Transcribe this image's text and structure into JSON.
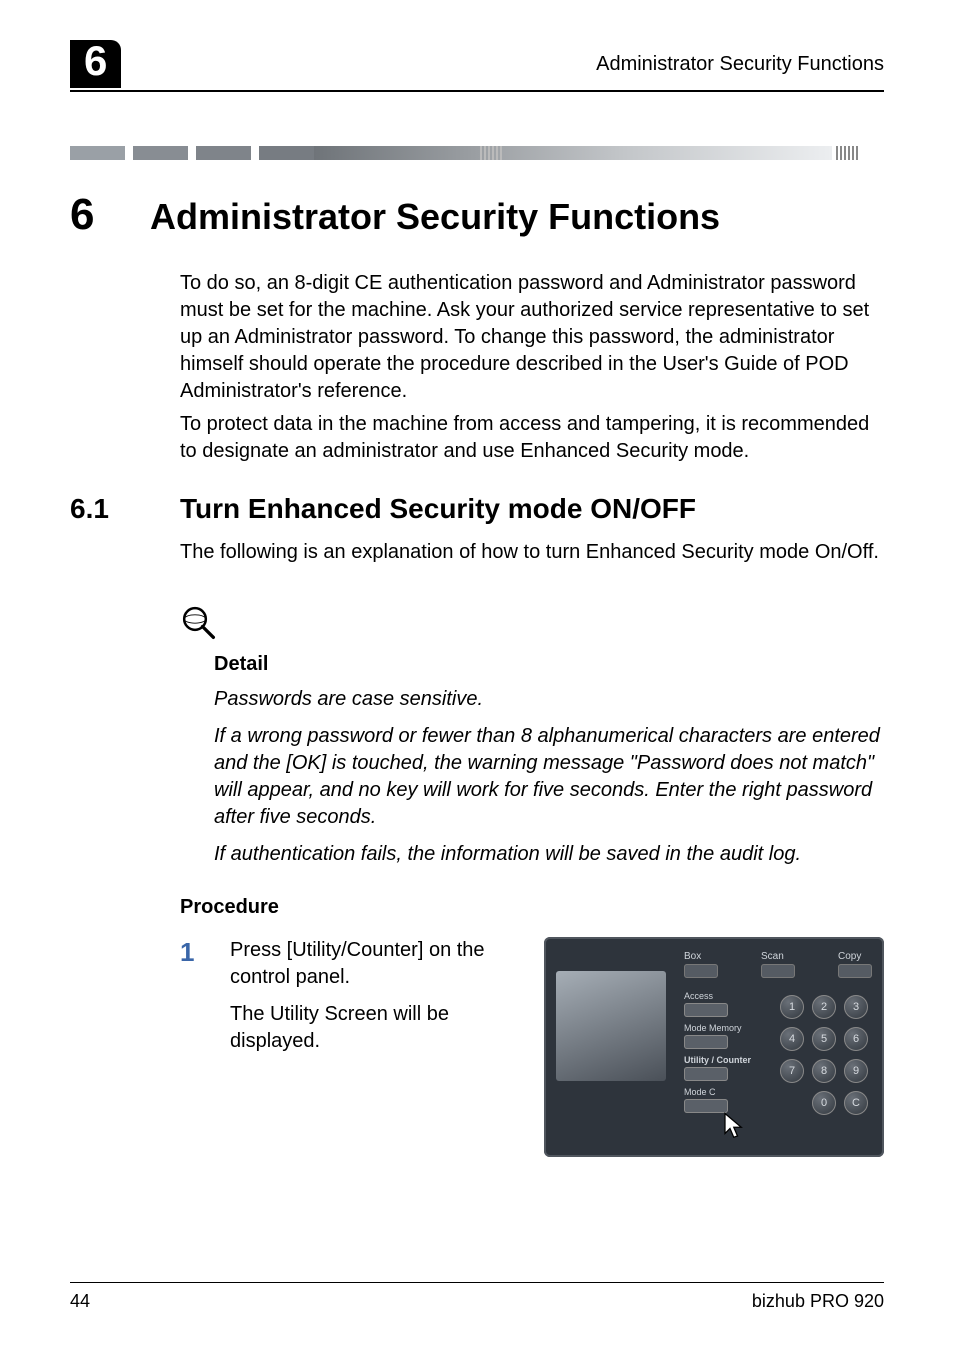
{
  "header": {
    "chapter_badge": "6",
    "running_title": "Administrator Security Functions"
  },
  "chapter": {
    "number": "6",
    "title": "Administrator Security Functions"
  },
  "intro": {
    "p1": "To do so, an 8-digit CE authentication password and Administrator password must be set for the machine. Ask your authorized service representative to set up an Administrator password. To change this password, the administrator himself should operate the procedure described in the User's Guide of POD Administrator's reference.",
    "p2": "To protect data in the machine from access and tampering, it is recommended to designate an administrator and use Enhanced Security mode."
  },
  "section": {
    "number": "6.1",
    "title": "Turn Enhanced Security mode ON/OFF",
    "lead": "The following is an explanation of how to turn Enhanced Security mode On/Off."
  },
  "detail": {
    "heading": "Detail",
    "d1": "Passwords are case sensitive.",
    "d2": "If a wrong password or fewer than 8 alphanumerical characters are entered and the [OK] is touched, the warning message \"Password does not match\" will appear, and no key will work for five seconds. Enter the right password after five seconds.",
    "d3": "If authentication fails, the information will be saved in the audit log."
  },
  "procedure": {
    "heading": "Procedure",
    "step1_num": "1",
    "step1_a": "Press [Utility/Counter] on the control panel.",
    "step1_b": "The Utility Screen will be displayed."
  },
  "panel": {
    "mode_box": "Box",
    "mode_scan": "Scan",
    "mode_copy": "Copy",
    "l_access": "Access",
    "l_modemem": "Mode Memory",
    "l_utility": "Utility / Counter",
    "l_modec": "Mode C",
    "keys": [
      "1",
      "2",
      "3",
      "4",
      "5",
      "6",
      "7",
      "8",
      "9",
      "0",
      "C"
    ]
  },
  "footer": {
    "page": "44",
    "product": "bizhub PRO 920"
  }
}
